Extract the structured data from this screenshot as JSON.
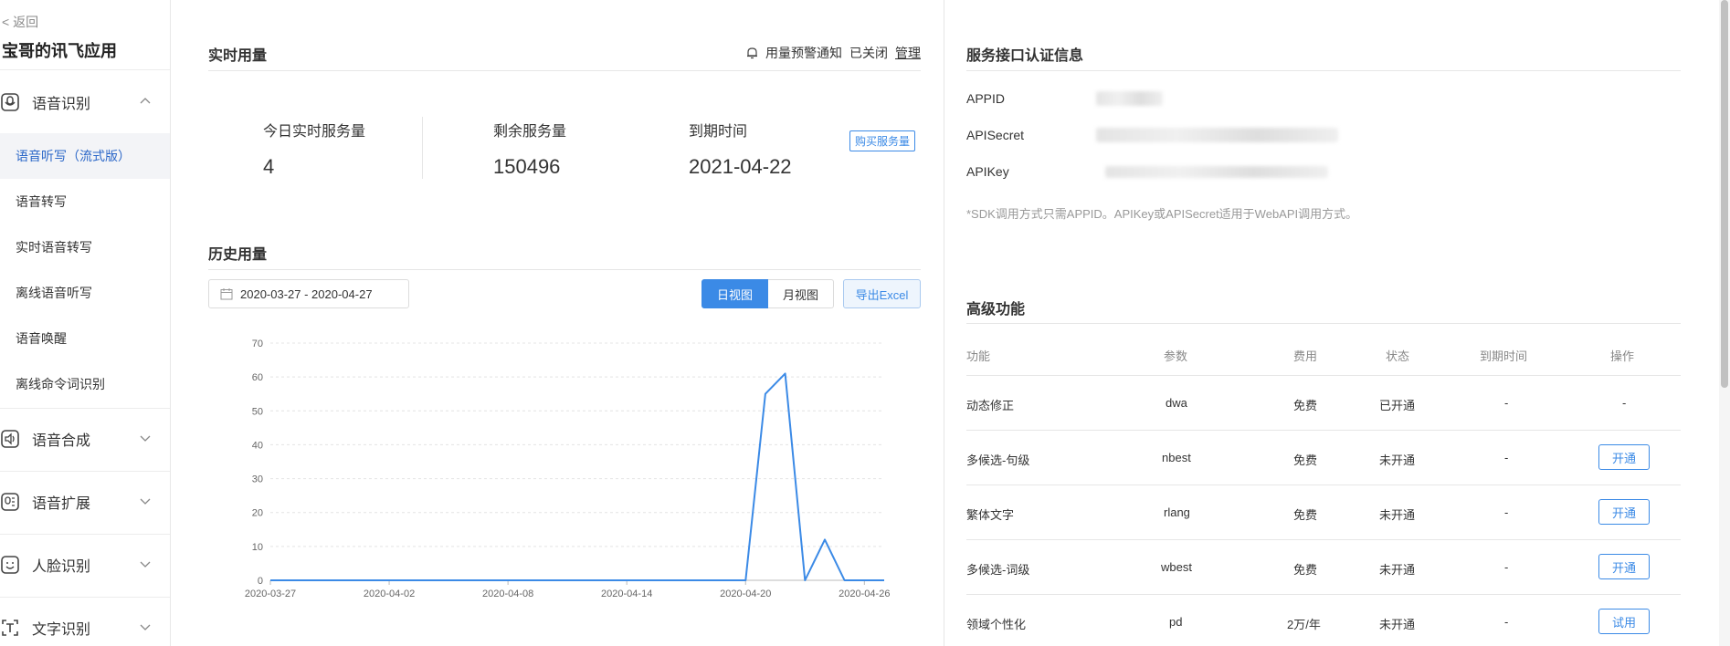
{
  "sidebar": {
    "back_label": "< 返回",
    "app_title": "宝哥的讯飞应用",
    "groups": [
      {
        "label": "语音识别",
        "icon": "speech-recognition-icon",
        "expanded": true
      },
      {
        "label": "语音合成",
        "icon": "speech-synthesis-icon",
        "expanded": false
      },
      {
        "label": "语音扩展",
        "icon": "speech-extension-icon",
        "expanded": false
      },
      {
        "label": "人脸识别",
        "icon": "face-recognition-icon",
        "expanded": false
      },
      {
        "label": "文字识别",
        "icon": "text-recognition-icon",
        "expanded": false
      }
    ],
    "items": [
      {
        "label": "语音听写（流式版）",
        "active": true
      },
      {
        "label": "语音转写",
        "active": false
      },
      {
        "label": "实时语音转写",
        "active": false
      },
      {
        "label": "离线语音听写",
        "active": false
      },
      {
        "label": "语音唤醒",
        "active": false
      },
      {
        "label": "离线命令词识别",
        "active": false
      }
    ]
  },
  "realtime": {
    "title": "实时用量",
    "alert_label": "用量预警通知",
    "alert_status": "已关闭",
    "manage_label": "管理",
    "stats": [
      {
        "label": "今日实时服务量",
        "value": "4"
      },
      {
        "label": "剩余服务量",
        "value": "150496"
      },
      {
        "label": "到期时间",
        "value": "2021-04-22"
      }
    ],
    "buy_label": "购买服务量"
  },
  "history": {
    "title": "历史用量",
    "date_range": "2020-03-27  - 2020-04-27",
    "day_view": "日视图",
    "month_view": "月视图",
    "export_label": "导出Excel"
  },
  "chart_data": {
    "type": "line",
    "x": [
      "2020-03-27",
      "2020-03-28",
      "2020-03-29",
      "2020-03-30",
      "2020-03-31",
      "2020-04-01",
      "2020-04-02",
      "2020-04-03",
      "2020-04-04",
      "2020-04-05",
      "2020-04-06",
      "2020-04-07",
      "2020-04-08",
      "2020-04-09",
      "2020-04-10",
      "2020-04-11",
      "2020-04-12",
      "2020-04-13",
      "2020-04-14",
      "2020-04-15",
      "2020-04-16",
      "2020-04-17",
      "2020-04-18",
      "2020-04-19",
      "2020-04-20",
      "2020-04-21",
      "2020-04-22",
      "2020-04-23",
      "2020-04-24",
      "2020-04-25",
      "2020-04-26",
      "2020-04-27"
    ],
    "series": [
      {
        "values": [
          0,
          0,
          0,
          0,
          0,
          0,
          0,
          0,
          0,
          0,
          0,
          0,
          0,
          0,
          0,
          0,
          0,
          0,
          0,
          0,
          0,
          0,
          0,
          0,
          0,
          55,
          61,
          0,
          12,
          0,
          0,
          0
        ]
      }
    ],
    "xticks": [
      "2020-03-27",
      "2020-04-02",
      "2020-04-08",
      "2020-04-14",
      "2020-04-20",
      "2020-04-26"
    ],
    "yticks": [
      0,
      10,
      20,
      30,
      40,
      50,
      60,
      70
    ],
    "ylim": [
      0,
      70
    ],
    "grid": true,
    "color": "#3b8ae6"
  },
  "auth": {
    "title": "服务接口认证信息",
    "keys": [
      "APPID",
      "APISecret",
      "APIKey"
    ],
    "note": "*SDK调用方式只需APPID。APIKey或APISecret适用于WebAPI调用方式。"
  },
  "advanced": {
    "title": "高级功能",
    "headers": [
      "功能",
      "参数",
      "费用",
      "状态",
      "到期时间",
      "操作"
    ],
    "rows": [
      {
        "name": "动态修正",
        "param": "dwa",
        "fee": "免费",
        "status": "已开通",
        "expire": "-",
        "action": "-"
      },
      {
        "name": "多候选-句级",
        "param": "nbest",
        "fee": "免费",
        "status": "未开通",
        "expire": "-",
        "action": "开通"
      },
      {
        "name": "繁体文字",
        "param": "rlang",
        "fee": "免费",
        "status": "未开通",
        "expire": "-",
        "action": "开通"
      },
      {
        "name": "多候选-词级",
        "param": "wbest",
        "fee": "免费",
        "status": "未开通",
        "expire": "-",
        "action": "开通"
      },
      {
        "name": "领域个性化",
        "param": "pd",
        "fee": "2万/年",
        "status": "未开通",
        "expire": "-",
        "action": "试用"
      }
    ]
  },
  "colors": {
    "accent": "#3b8ae6",
    "active_nav_text": "#2b67c8"
  }
}
